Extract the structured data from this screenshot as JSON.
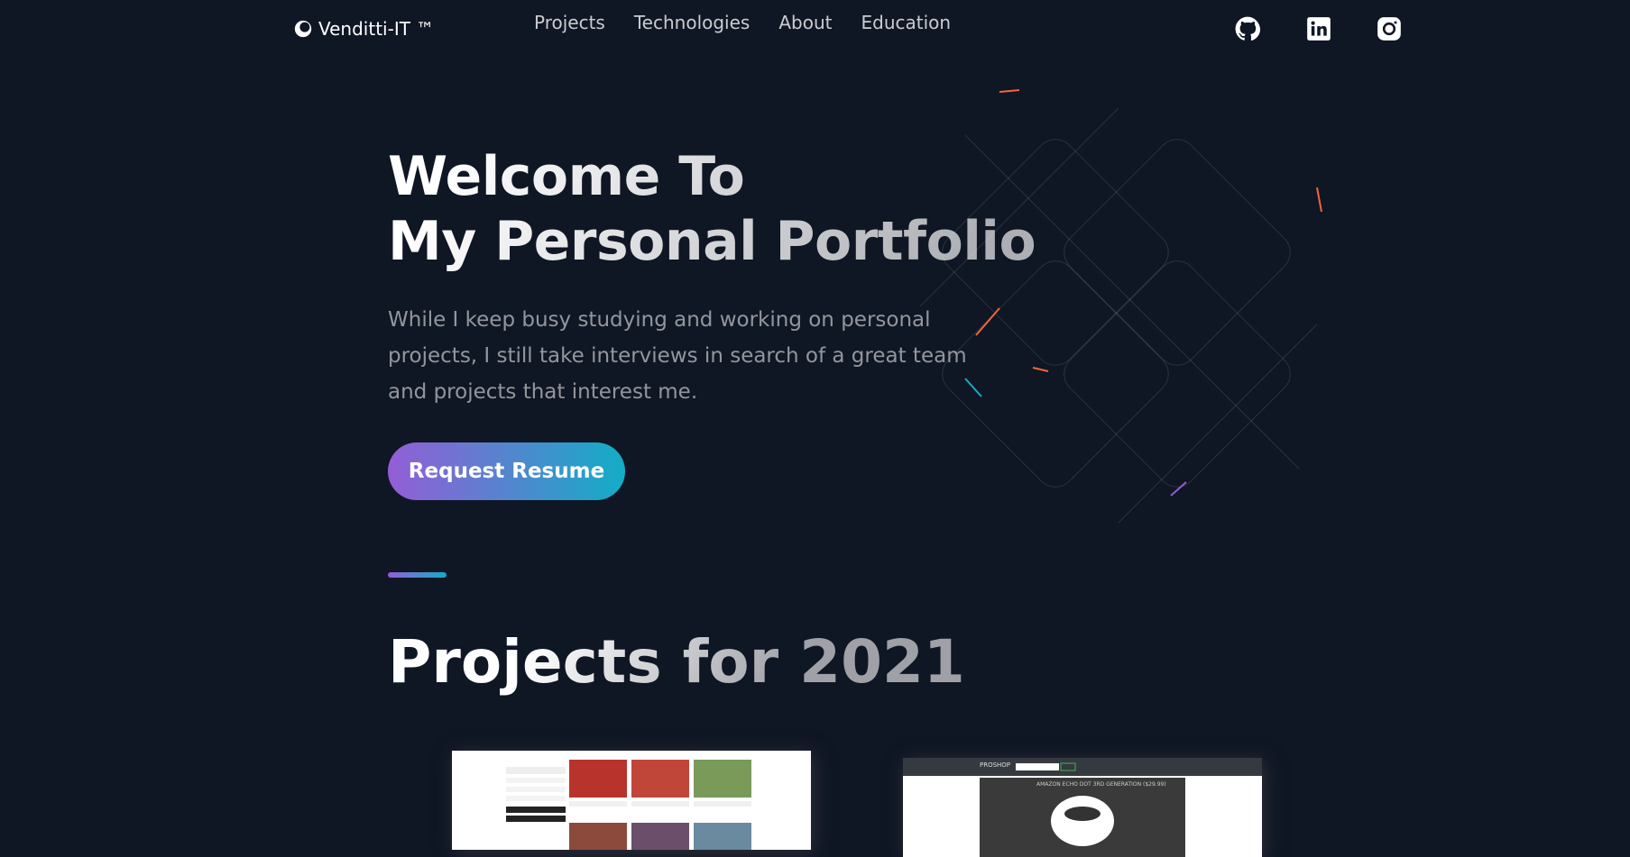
{
  "nav": {
    "logo_text": "Venditti-IT ™",
    "links": [
      "Projects",
      "Technologies",
      "About",
      "Education"
    ],
    "social": [
      "github-icon",
      "linkedin-icon",
      "instagram-icon"
    ]
  },
  "hero": {
    "title_line1": "Welcome To",
    "title_line2": "My Personal Portfolio",
    "text": "While I keep busy studying and working on personal projects, I still take interviews in search of a great team and projects that interest me.",
    "cta": "Request Resume"
  },
  "projects": {
    "title": "Projects for 2021",
    "card2": {
      "brand": "PROSHOP",
      "product_title": "AMAZON ECHO DOT 3RD GENERATION ($29.99)"
    }
  },
  "colors": {
    "background": "#0f1624",
    "gradient_start": "#945dd6",
    "gradient_end": "#13adc7"
  }
}
